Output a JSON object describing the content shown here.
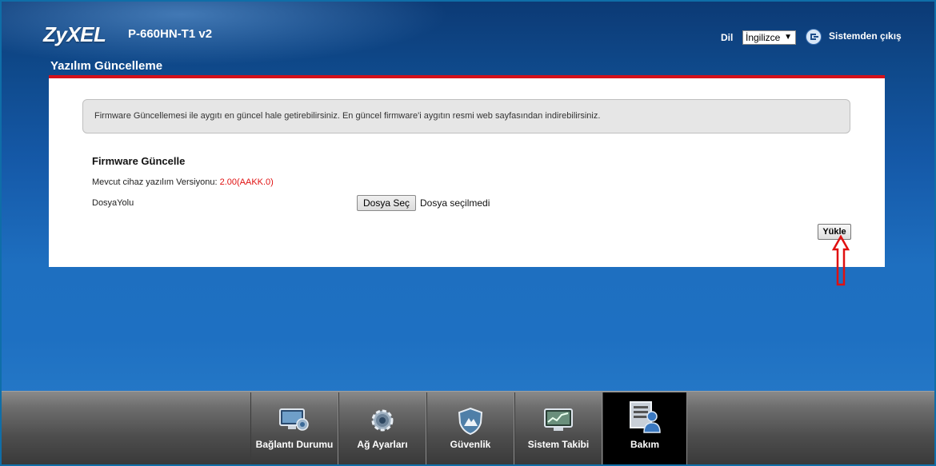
{
  "header": {
    "logo": "ZyXEL",
    "model": "P-660HN-T1 v2",
    "language_label": "Dil",
    "language_selected": "İngilizce",
    "logout_label": "Sistemden çıkış"
  },
  "page": {
    "title": "Yazılım Güncelleme",
    "info_text": "Firmware Güncellemesi ile aygıtı en güncel hale getirebilirsiniz. En güncel firmware'i aygıtın resmi web sayfasından indirebilirsiniz.",
    "section_title": "Firmware Güncelle",
    "version_label": "Mevcut cihaz yazılım Versiyonu:",
    "version_value": "2.00(AAKK.0)",
    "path_label": "DosyaYolu",
    "choose_file_label": "Dosya Seç",
    "no_file_text": "Dosya seçilmedi",
    "upload_label": "Yükle"
  },
  "nav": {
    "items": [
      {
        "label": "Bağlantı Durumu",
        "icon": "monitor-icon"
      },
      {
        "label": "Ağ Ayarları",
        "icon": "gear-icon"
      },
      {
        "label": "Güvenlik",
        "icon": "shield-icon"
      },
      {
        "label": "Sistem Takibi",
        "icon": "chart-monitor-icon"
      },
      {
        "label": "Bakım",
        "icon": "maintenance-icon"
      }
    ],
    "active": "Bakım"
  },
  "colors": {
    "accent_red": "#d4111a",
    "version_red": "#e01010",
    "background_blue": "#1559a8"
  }
}
